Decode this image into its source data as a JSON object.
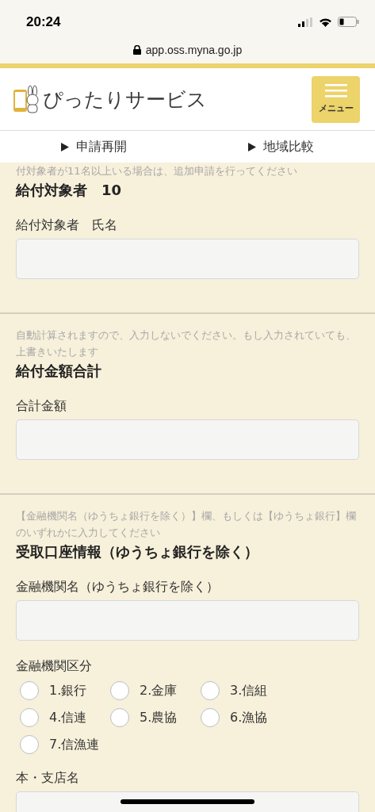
{
  "status_bar": {
    "time": "20:24",
    "url": "app.oss.myna.go.jp"
  },
  "header": {
    "logo_text": "ぴったりサービス",
    "menu_label": "メニュー"
  },
  "nav": [
    {
      "label": "申請再開"
    },
    {
      "label": "地域比較"
    }
  ],
  "sections": [
    {
      "hint": "付対象者が11名以上いる場合は、追加申請を行ってください",
      "title": "給付対象者　10",
      "fields": [
        {
          "kind": "text",
          "label": "給付対象者　氏名"
        }
      ]
    },
    {
      "hint": "自動計算されますので、入力しないでください。もし入力されていても、上書きいたします",
      "title": "給付金額合計",
      "fields": [
        {
          "kind": "text",
          "label": "合計金額"
        }
      ]
    },
    {
      "hint": "【金融機関名（ゆうちょ銀行を除く）】欄、もしくは【ゆうちょ銀行】欄のいずれかに入力してください",
      "title": "受取口座情報（ゆうちょ銀行を除く）",
      "fields": [
        {
          "kind": "text",
          "label": "金融機関名（ゆうちょ銀行を除く）"
        },
        {
          "kind": "radio",
          "label": "金融機関区分",
          "options": [
            {
              "label": "1.銀行",
              "selected": false
            },
            {
              "label": "2.金庫",
              "selected": false
            },
            {
              "label": "3.信組",
              "selected": false
            },
            {
              "label": "4.信連",
              "selected": false
            },
            {
              "label": "5.農協",
              "selected": false
            },
            {
              "label": "6.漁協",
              "selected": false
            },
            {
              "label": "7.信漁連",
              "selected": false
            }
          ]
        },
        {
          "kind": "text",
          "label": "本・支店名"
        }
      ]
    }
  ]
}
